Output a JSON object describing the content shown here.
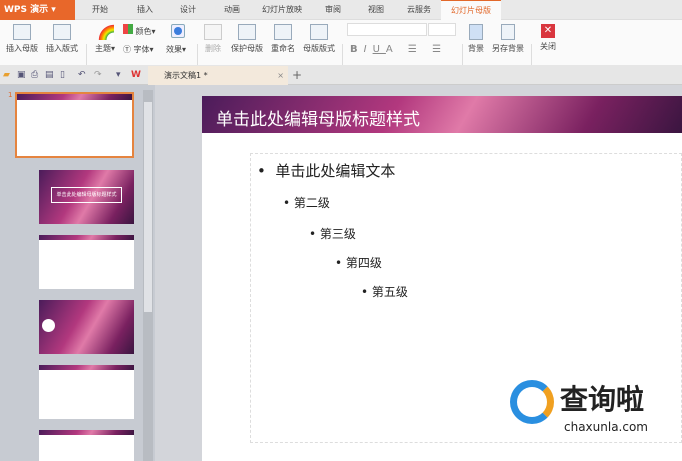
{
  "app": {
    "name": "WPS 演示"
  },
  "tabs": [
    "开始",
    "插入",
    "设计",
    "动画",
    "幻灯片放映",
    "审阅",
    "视图",
    "云服务",
    "幻灯片母版"
  ],
  "active_tab": "幻灯片母版",
  "ribbon": {
    "insert_master": "插入母版",
    "insert_layout": "插入版式",
    "theme": "主题",
    "color": "颜色",
    "font": "字体",
    "effect": "效果",
    "delete": "删除",
    "protect_master": "保护母版",
    "rename": "重命名",
    "master_layout": "母版版式",
    "bold": "B",
    "italic": "I",
    "underline": "U",
    "fontcolor": "A",
    "background": "背景",
    "save_background": "另存背景",
    "close": "关闭"
  },
  "document": {
    "tab_name": "演示文稿1 *"
  },
  "slide": {
    "title": "单击此处编辑母版标题样式",
    "levels": [
      "单击此处编辑文本",
      "第二级",
      "第三级",
      "第四级",
      "第五级"
    ]
  },
  "thumbnails": {
    "first_number": "1",
    "title_text": "单击此处编辑母版标题样式"
  },
  "watermark": {
    "name": "查询啦",
    "url": "chaxunla.com"
  }
}
